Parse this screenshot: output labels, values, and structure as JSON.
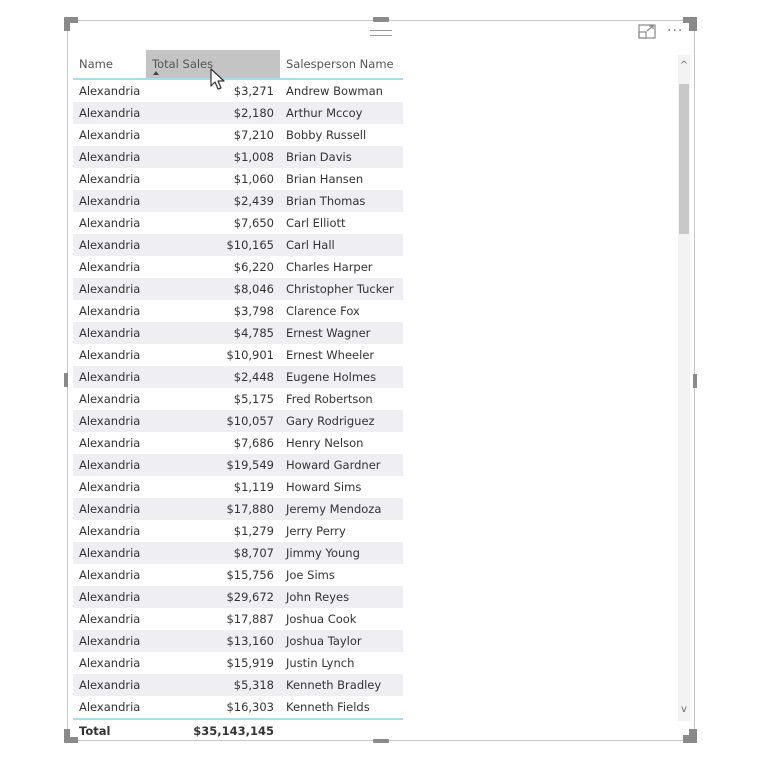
{
  "visual_header": {
    "focus_mode_icon": "focus-mode-icon",
    "more_options_icon": "more-options-icon",
    "more_options_label": "···"
  },
  "table": {
    "columns": [
      {
        "label": "Name",
        "sorted": false
      },
      {
        "label": "Total Sales",
        "sorted": true,
        "sort_direction": "ascending"
      },
      {
        "label": "Salesperson Name",
        "sorted": false
      }
    ],
    "rows": [
      {
        "name": "Alexandria",
        "total_sales": "$3,271",
        "salesperson": "Andrew Bowman"
      },
      {
        "name": "Alexandria",
        "total_sales": "$2,180",
        "salesperson": "Arthur Mccoy"
      },
      {
        "name": "Alexandria",
        "total_sales": "$7,210",
        "salesperson": "Bobby Russell"
      },
      {
        "name": "Alexandria",
        "total_sales": "$1,008",
        "salesperson": "Brian Davis"
      },
      {
        "name": "Alexandria",
        "total_sales": "$1,060",
        "salesperson": "Brian Hansen"
      },
      {
        "name": "Alexandria",
        "total_sales": "$2,439",
        "salesperson": "Brian Thomas"
      },
      {
        "name": "Alexandria",
        "total_sales": "$7,650",
        "salesperson": "Carl Elliott"
      },
      {
        "name": "Alexandria",
        "total_sales": "$10,165",
        "salesperson": "Carl Hall"
      },
      {
        "name": "Alexandria",
        "total_sales": "$6,220",
        "salesperson": "Charles Harper"
      },
      {
        "name": "Alexandria",
        "total_sales": "$8,046",
        "salesperson": "Christopher Tucker"
      },
      {
        "name": "Alexandria",
        "total_sales": "$3,798",
        "salesperson": "Clarence Fox"
      },
      {
        "name": "Alexandria",
        "total_sales": "$4,785",
        "salesperson": "Ernest Wagner"
      },
      {
        "name": "Alexandria",
        "total_sales": "$10,901",
        "salesperson": "Ernest Wheeler"
      },
      {
        "name": "Alexandria",
        "total_sales": "$2,448",
        "salesperson": "Eugene Holmes"
      },
      {
        "name": "Alexandria",
        "total_sales": "$5,175",
        "salesperson": "Fred Robertson"
      },
      {
        "name": "Alexandria",
        "total_sales": "$10,057",
        "salesperson": "Gary Rodriguez"
      },
      {
        "name": "Alexandria",
        "total_sales": "$7,686",
        "salesperson": "Henry Nelson"
      },
      {
        "name": "Alexandria",
        "total_sales": "$19,549",
        "salesperson": "Howard Gardner"
      },
      {
        "name": "Alexandria",
        "total_sales": "$1,119",
        "salesperson": "Howard Sims"
      },
      {
        "name": "Alexandria",
        "total_sales": "$17,880",
        "salesperson": "Jeremy Mendoza"
      },
      {
        "name": "Alexandria",
        "total_sales": "$1,279",
        "salesperson": "Jerry Perry"
      },
      {
        "name": "Alexandria",
        "total_sales": "$8,707",
        "salesperson": "Jimmy Young"
      },
      {
        "name": "Alexandria",
        "total_sales": "$15,756",
        "salesperson": "Joe Sims"
      },
      {
        "name": "Alexandria",
        "total_sales": "$29,672",
        "salesperson": "John Reyes"
      },
      {
        "name": "Alexandria",
        "total_sales": "$17,887",
        "salesperson": "Joshua Cook"
      },
      {
        "name": "Alexandria",
        "total_sales": "$13,160",
        "salesperson": "Joshua Taylor"
      },
      {
        "name": "Alexandria",
        "total_sales": "$15,919",
        "salesperson": "Justin Lynch"
      },
      {
        "name": "Alexandria",
        "total_sales": "$5,318",
        "salesperson": "Kenneth Bradley"
      },
      {
        "name": "Alexandria",
        "total_sales": "$16,303",
        "salesperson": "Kenneth Fields"
      }
    ],
    "total": {
      "label": "Total",
      "total_sales": "$35,143,145",
      "salesperson": ""
    }
  },
  "scrollbar": {
    "up_label": "^",
    "down_label": "v",
    "position_fraction": 0.0
  },
  "colors": {
    "header_rule": "#a9dde3",
    "sorted_header_bg": "#c4c4c4",
    "band_row_bg": "#eeeef3"
  }
}
